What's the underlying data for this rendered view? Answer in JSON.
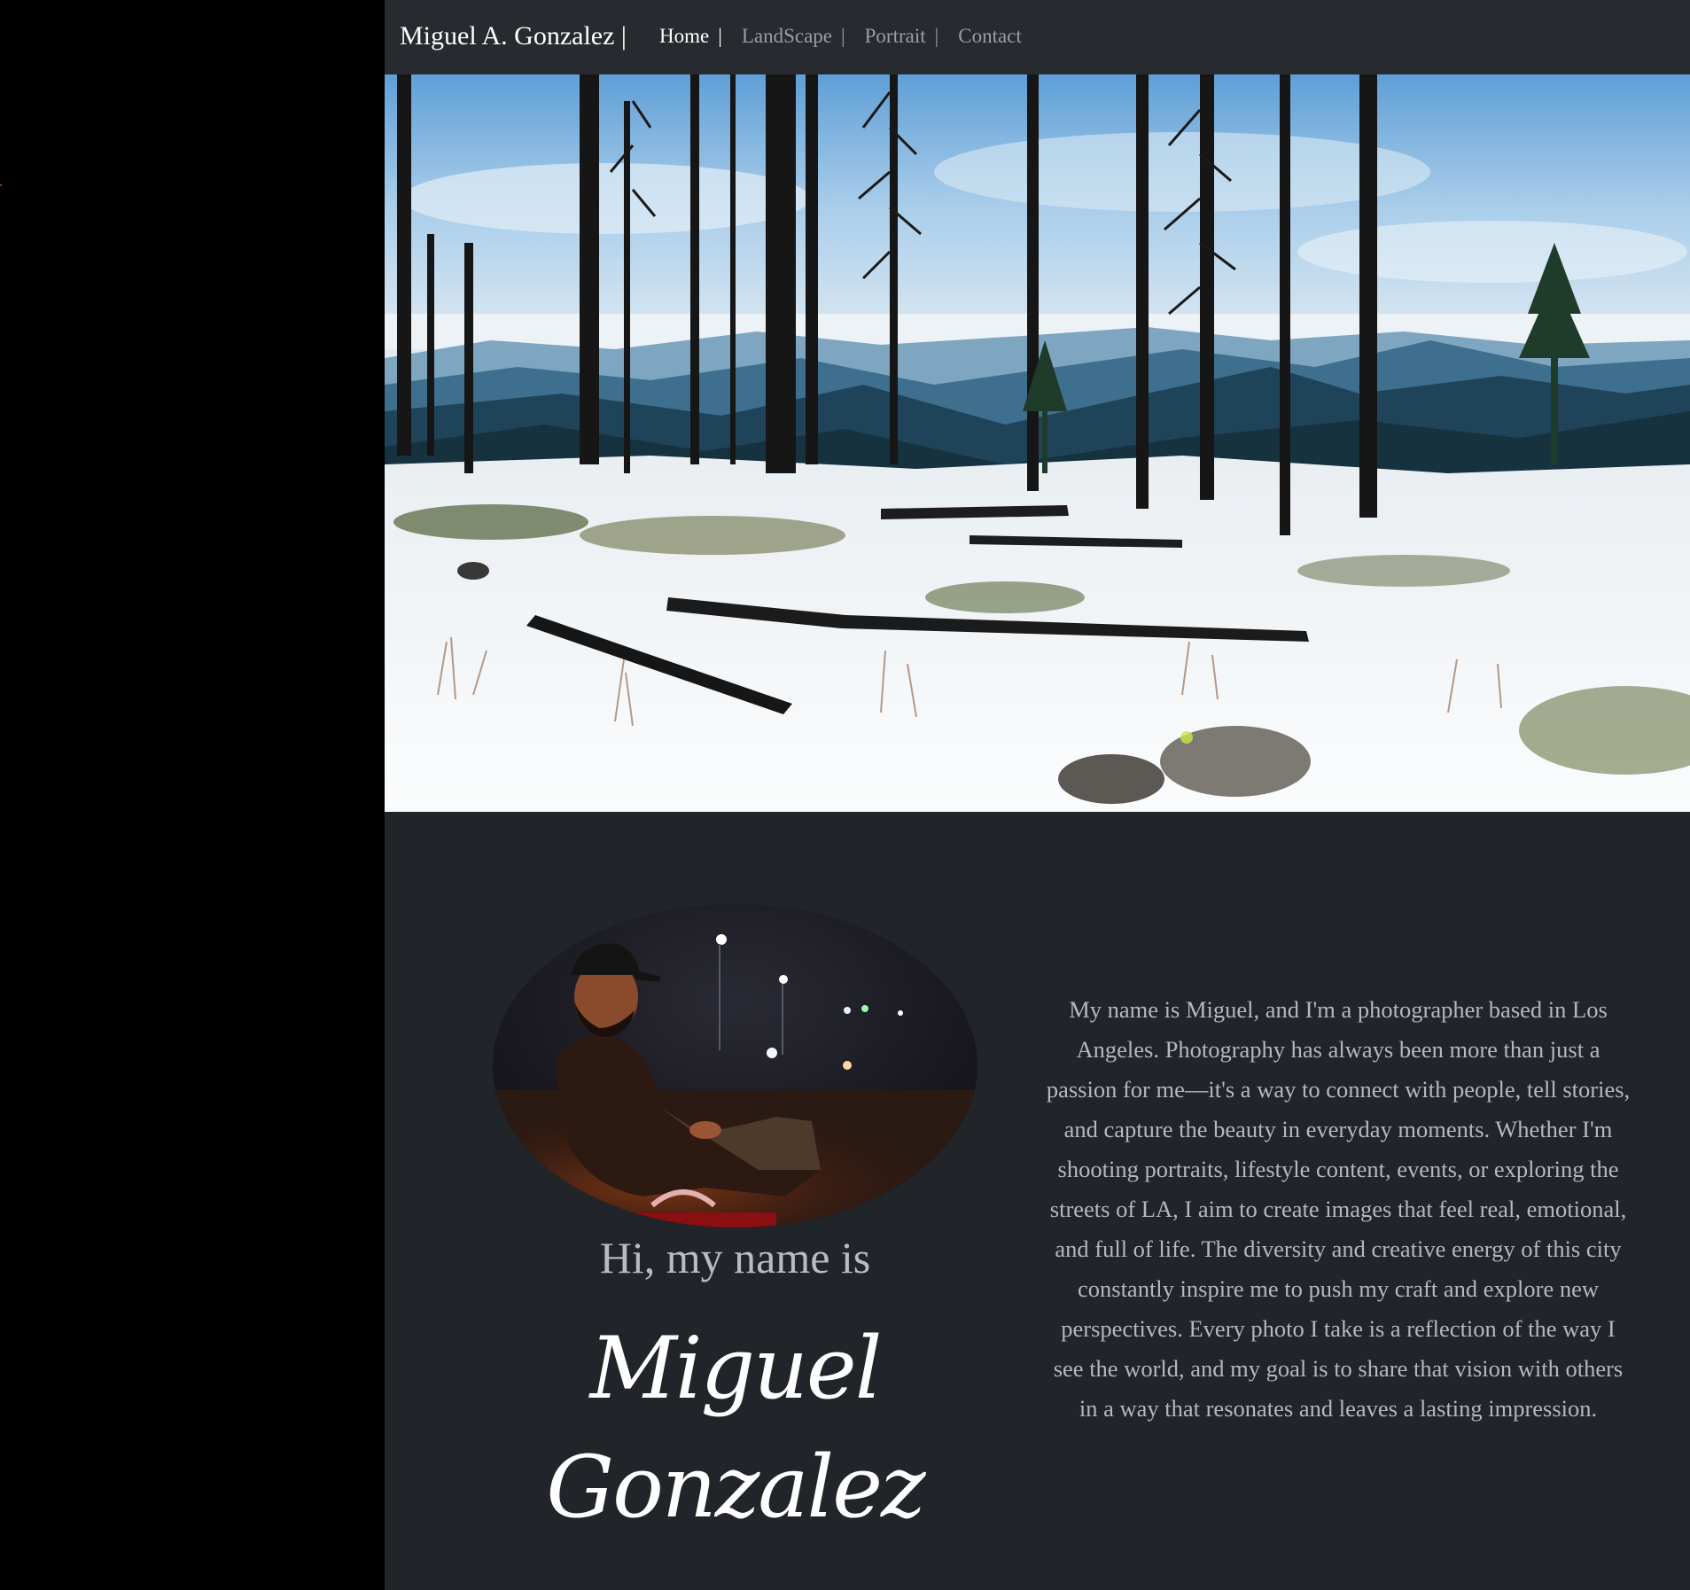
{
  "navbar": {
    "brand": "Miguel A. Gonzalez |",
    "links": [
      {
        "label": "Home",
        "sep": "|",
        "active": true
      },
      {
        "label": "LandScape",
        "sep": "|",
        "active": false
      },
      {
        "label": "Portrait",
        "sep": "|",
        "active": false
      },
      {
        "label": "Contact",
        "sep": "",
        "active": false
      }
    ]
  },
  "hero": {
    "image": "snowy-burned-forest-mountain-landscape"
  },
  "about": {
    "portrait_image": "man-in-cap-sitting-by-fire-at-night",
    "greeting": "Hi, my name is",
    "first_name": "Miguel",
    "last_name": "Gonzalez",
    "bio": "My name is Miguel, and I'm a photographer based in Los Angeles. Photography has always been more than just a passion for me—it's a way to connect with people, tell stories, and capture the beauty in everyday moments. Whether I'm shooting portraits, lifestyle content, events, or exploring the streets of LA, I aim to create images that feel real, emotional, and full of life. The diversity and creative energy of this city constantly inspire me to push my craft and explore new perspectives. Every photo I take is a reflection of the way I see the world, and my goal is to share that vision with others in a way that resonates and leaves a lasting impression."
  },
  "colors": {
    "page_bg": "#212428",
    "navbar_bg": "#272b2f",
    "gutter_bg": "#000000",
    "text_muted": "#b4b9bf",
    "text_white": "#ffffff"
  }
}
